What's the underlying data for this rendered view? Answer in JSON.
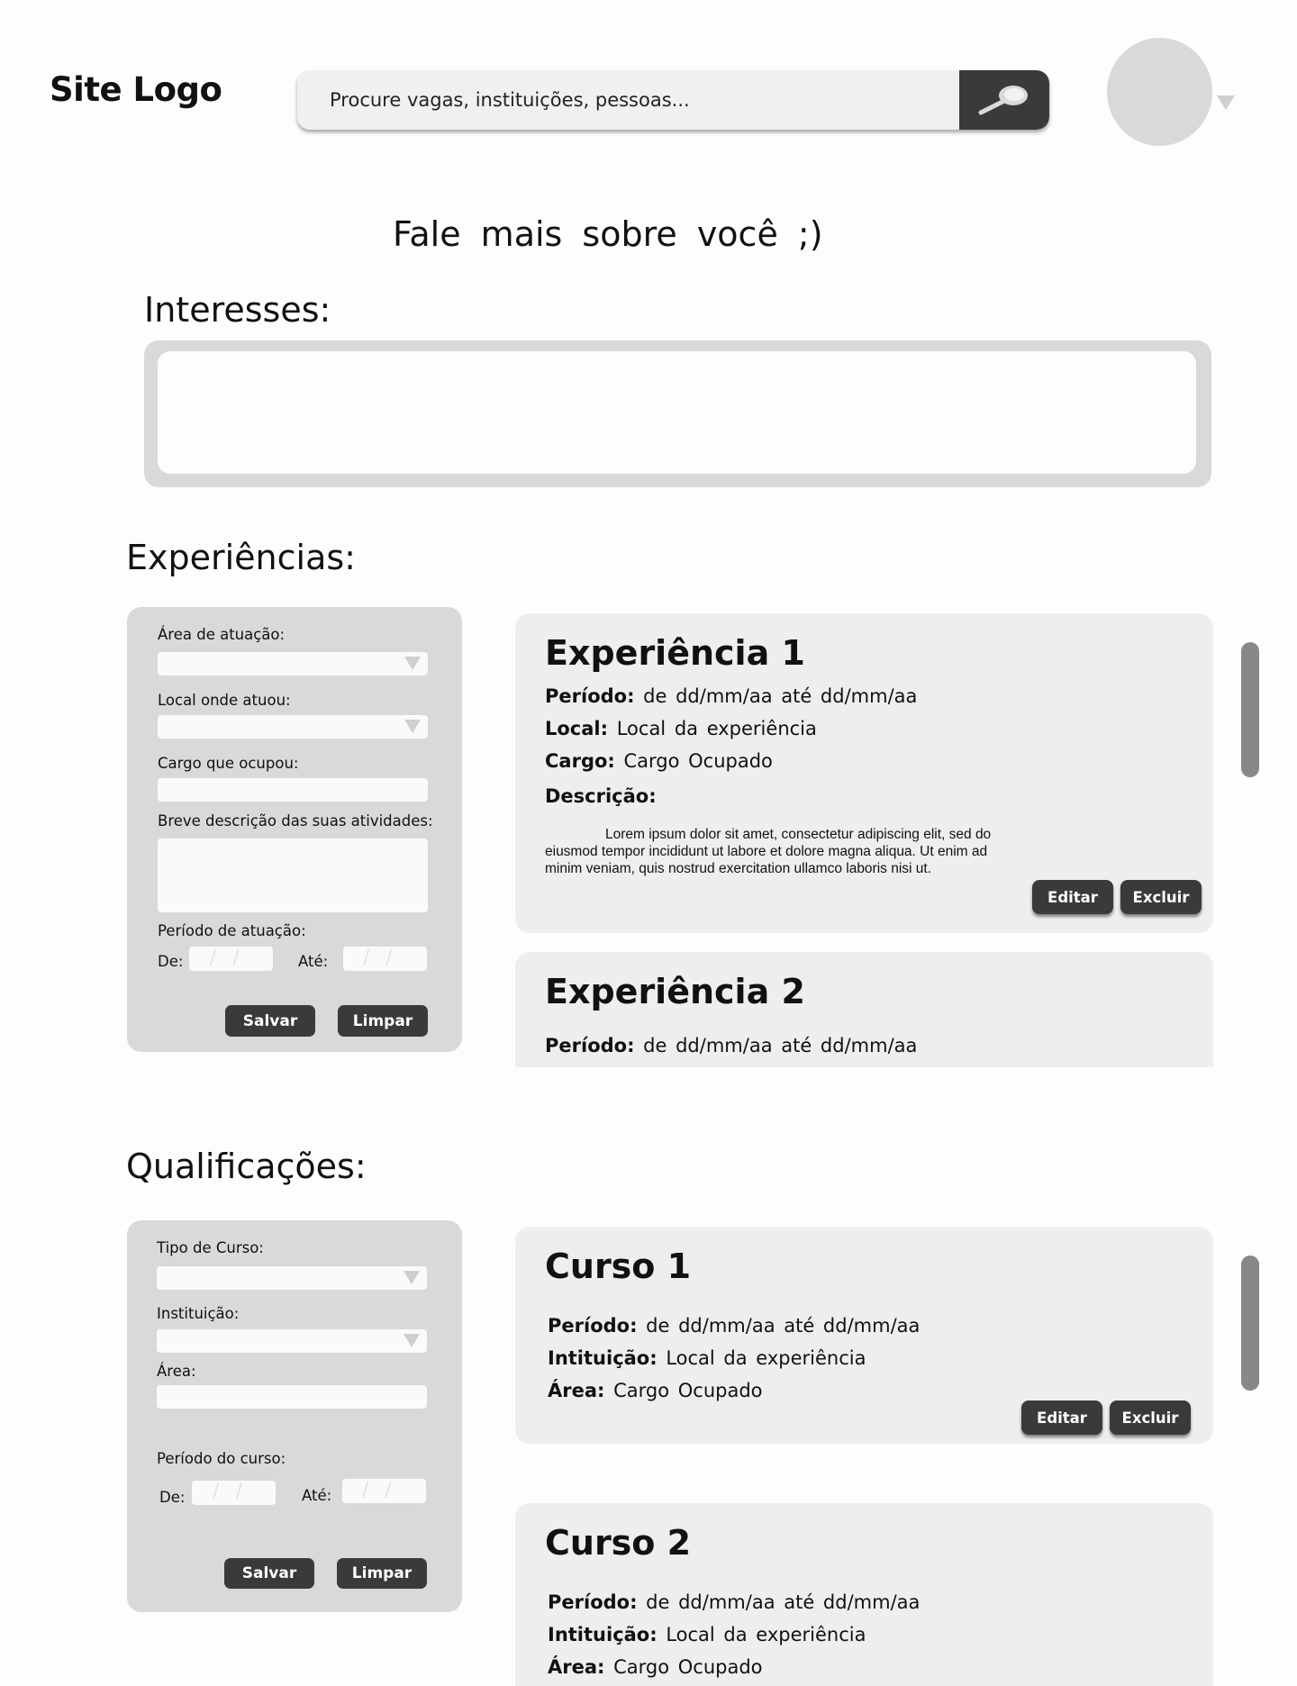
{
  "header": {
    "logo": "Site Logo",
    "search_placeholder": "Procure vagas, instituições, pessoas..."
  },
  "page_heading": "Fale  mais  sobre você ;)",
  "interests": {
    "title": "Interesses:"
  },
  "experiences": {
    "title": "Experiências:",
    "form": {
      "area_label": "Área de atuação:",
      "local_label": "Local onde atuou:",
      "cargo_label": "Cargo que ocupou:",
      "descricao_label": "Breve descrição das suas atividades:",
      "periodo_label": "Período de atuação:",
      "de_label": "De:",
      "ate_label": "Até:",
      "save_label": "Salvar",
      "clear_label": "Limpar"
    },
    "cards": [
      {
        "title": "Experiência 1",
        "periodo_label": "Período:",
        "periodo_value": "de  dd/mm/aa  até  dd/mm/aa",
        "local_label": "Local:",
        "local_value": "Local da experiência",
        "cargo_label": "Cargo:",
        "cargo_value": "Cargo Ocupado",
        "descricao_label": "Descrição:",
        "descricao_text": "Lorem ipsum dolor sit amet, consectetur adipiscing elit, sed do eiusmod tempor incididunt ut labore et dolore magna aliqua. Ut enim ad minim veniam, quis nostrud exercitation ullamco laboris nisi ut.",
        "edit_label": "Editar",
        "delete_label": "Excluir"
      },
      {
        "title": "Experiência 2",
        "periodo_label": "Período:",
        "periodo_value": "de  dd/mm/aa  até  dd/mm/aa"
      }
    ]
  },
  "qualifications": {
    "title": "Qualificações:",
    "form": {
      "tipo_label": "Tipo de Curso:",
      "instituicao_label": "Instituição:",
      "area_label": "Área:",
      "periodo_label": "Período do curso:",
      "de_label": "De:",
      "ate_label": "Até:",
      "save_label": "Salvar",
      "clear_label": "Limpar"
    },
    "cards": [
      {
        "title": "Curso 1",
        "periodo_label": "Período:",
        "periodo_value": "de  dd/mm/aa  até  dd/mm/aa",
        "instituicao_label": "Intituição:",
        "instituicao_value": "Local da experiência",
        "area_label": "Área:",
        "area_value": "Cargo Ocupado",
        "edit_label": "Editar",
        "delete_label": "Excluir"
      },
      {
        "title": "Curso 2",
        "periodo_label": "Período:",
        "periodo_value": "de  dd/mm/aa  até  dd/mm/aa",
        "instituicao_label": "Intituição:",
        "instituicao_value": "Local da experiência",
        "area_label": "Área:",
        "area_value": "Cargo Ocupado"
      }
    ]
  }
}
